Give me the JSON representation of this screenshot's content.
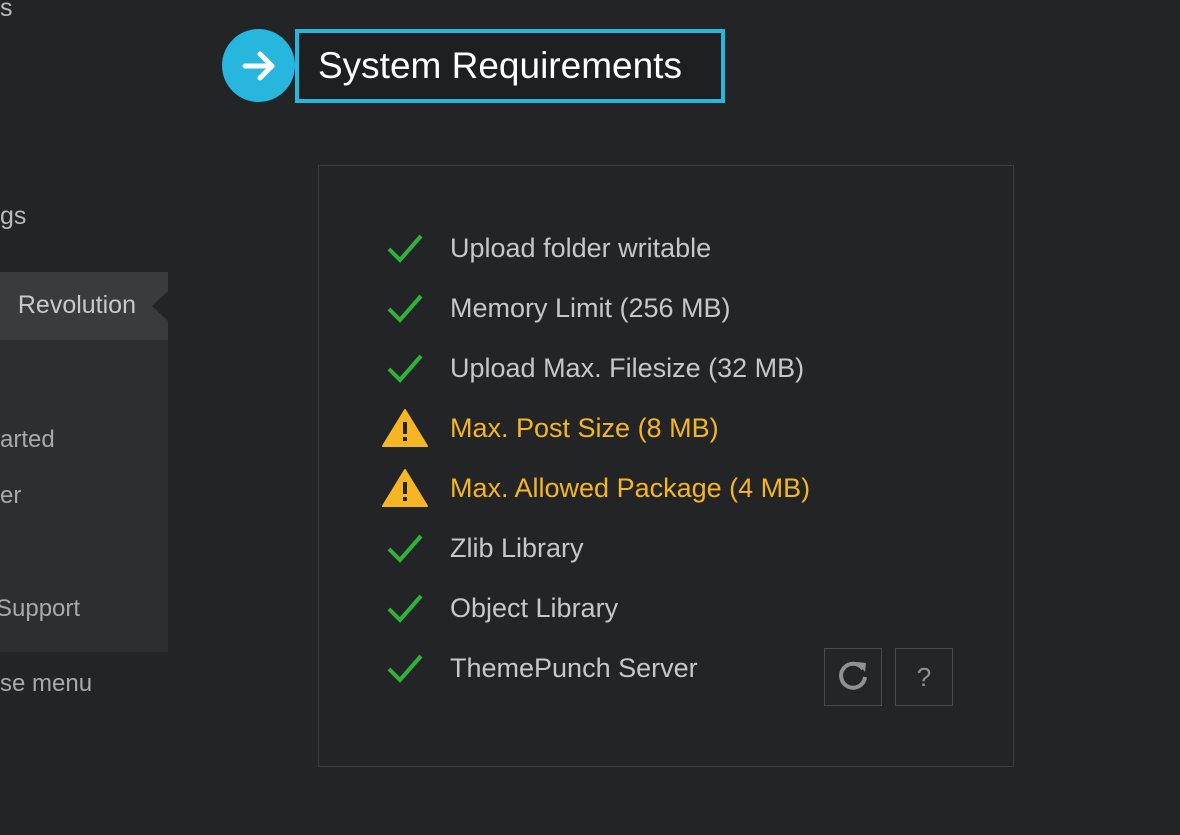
{
  "sidebar": {
    "items": [
      {
        "label": "s"
      },
      {
        "label": "gs"
      },
      {
        "label": "Revolution"
      },
      {
        "label": "arted"
      },
      {
        "label": "er"
      },
      {
        "label": "Support"
      },
      {
        "label": "se menu"
      }
    ]
  },
  "header": {
    "title": "System Requirements",
    "icon": "arrow-right-icon",
    "accent": "#27b7de"
  },
  "requirements": [
    {
      "label": "Upload folder writable",
      "status": "ok"
    },
    {
      "label": "Memory Limit (256 MB)",
      "status": "ok"
    },
    {
      "label": "Upload Max. Filesize (32 MB)",
      "status": "ok"
    },
    {
      "label": "Max. Post Size (8 MB)",
      "status": "warning"
    },
    {
      "label": "Max. Allowed Package (4 MB)",
      "status": "warning"
    },
    {
      "label": "Zlib Library",
      "status": "ok"
    },
    {
      "label": "Object Library",
      "status": "ok"
    },
    {
      "label": "ThemePunch Server",
      "status": "ok"
    }
  ],
  "buttons": {
    "refresh_icon": "refresh-icon",
    "help_label": "?"
  },
  "colors": {
    "ok": "#2fb33a",
    "warning": "#f6b624"
  }
}
